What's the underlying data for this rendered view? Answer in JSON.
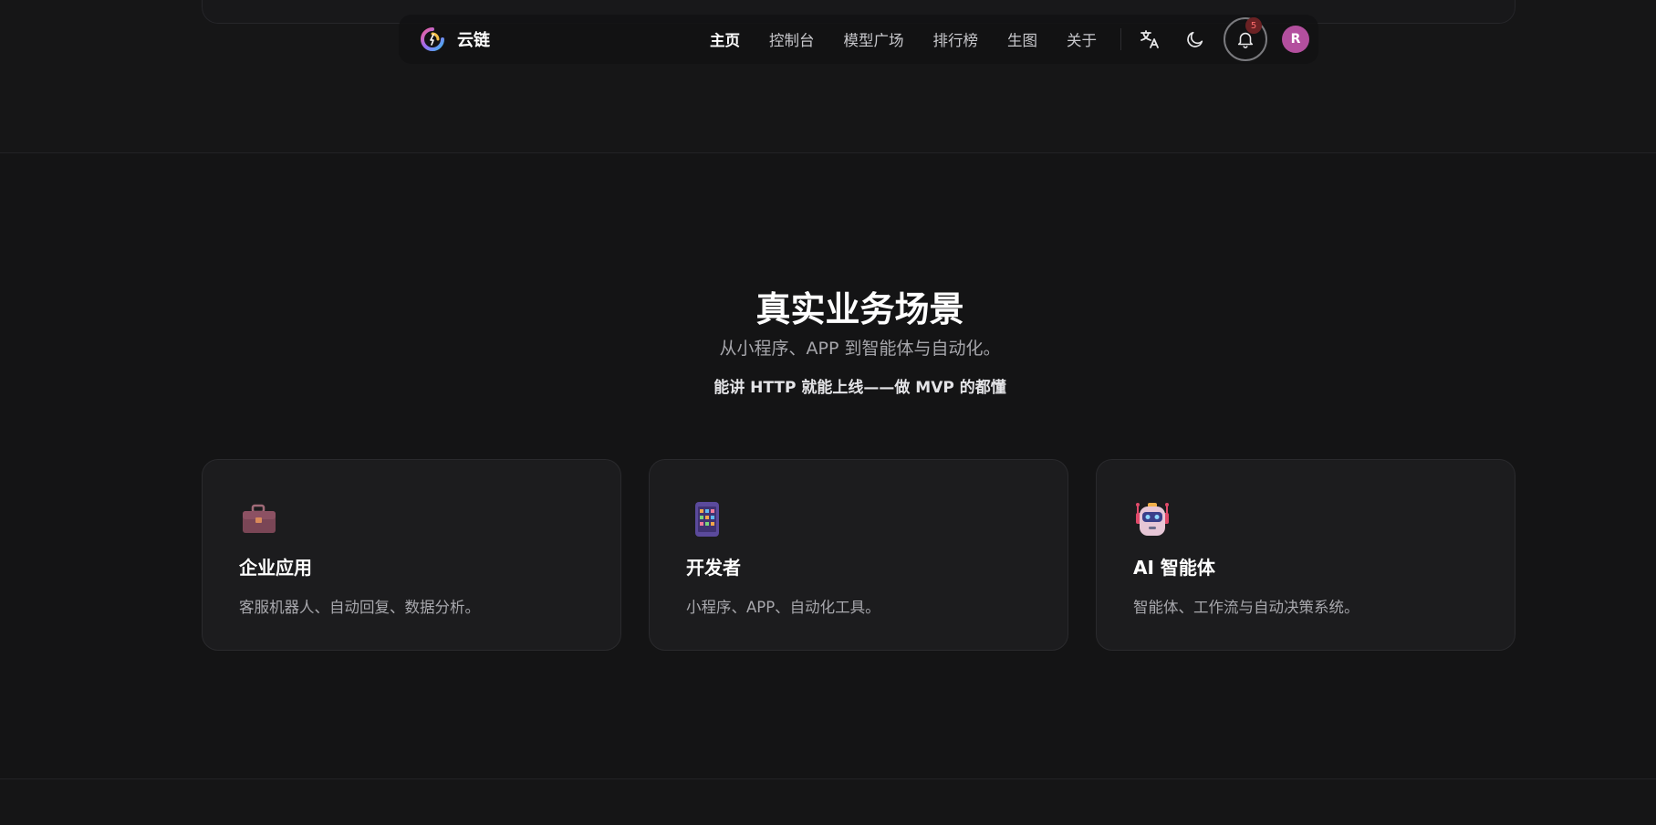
{
  "navbar": {
    "brand": "云链",
    "links": [
      {
        "label": "主页",
        "active": true
      },
      {
        "label": "控制台",
        "active": false
      },
      {
        "label": "模型广场",
        "active": false
      },
      {
        "label": "排行榜",
        "active": false
      },
      {
        "label": "生图",
        "active": false
      },
      {
        "label": "关于",
        "active": false
      }
    ],
    "notification_count": "5",
    "avatar_initial": "R",
    "icons": {
      "translate": "translate-icon",
      "theme": "moon-icon",
      "notifications": "bell-icon"
    }
  },
  "section": {
    "title": "真实业务场景",
    "subtitle": "从小程序、APP 到智能体与自动化。",
    "note": "能讲 HTTP 就能上线——做 MVP 的都懂"
  },
  "cards": [
    {
      "icon": "briefcase-icon",
      "title": "企业应用",
      "desc": "客服机器人、自动回复、数据分析。"
    },
    {
      "icon": "mobile-phone-icon",
      "title": "开发者",
      "desc": "小程序、APP、自动化工具。"
    },
    {
      "icon": "robot-icon",
      "title": "AI 智能体",
      "desc": "智能体、工作流与自动决策系统。"
    }
  ],
  "colors": {
    "background": "#141415",
    "card": "#1c1c1e",
    "avatar": "#b34f9e",
    "badge": "#6b2224"
  }
}
